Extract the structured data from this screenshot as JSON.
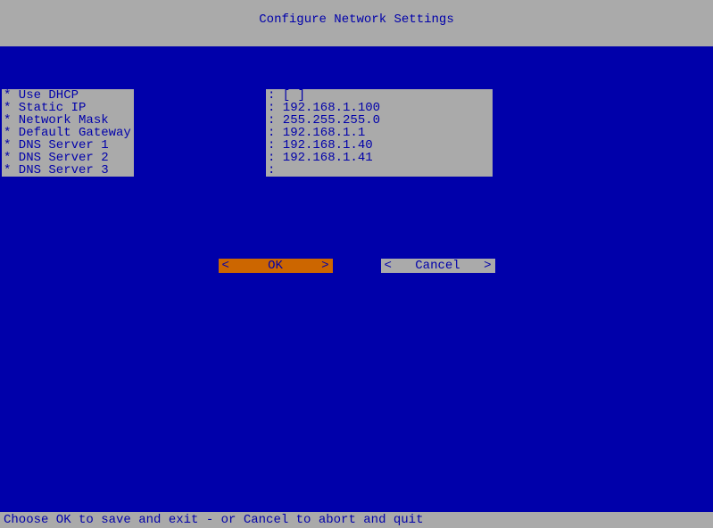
{
  "title": "Configure Network Settings",
  "fields": [
    {
      "label": "* Use DHCP",
      "value": ": [ ]"
    },
    {
      "label": "* Static IP",
      "value": ": 192.168.1.100"
    },
    {
      "label": "* Network Mask",
      "value": ": 255.255.255.0"
    },
    {
      "label": "* Default Gateway",
      "value": ": 192.168.1.1"
    },
    {
      "label": "* DNS Server 1",
      "value": ": 192.168.1.40"
    },
    {
      "label": "* DNS Server 2",
      "value": ": 192.168.1.41"
    },
    {
      "label": "* DNS Server 3",
      "value": ":"
    }
  ],
  "buttons": {
    "ok": {
      "left": "<",
      "text": "OK",
      "right": ">"
    },
    "cancel": {
      "left": "<",
      "text": "Cancel",
      "right": ">"
    }
  },
  "footer": "Choose OK to save and exit - or Cancel to abort and quit"
}
